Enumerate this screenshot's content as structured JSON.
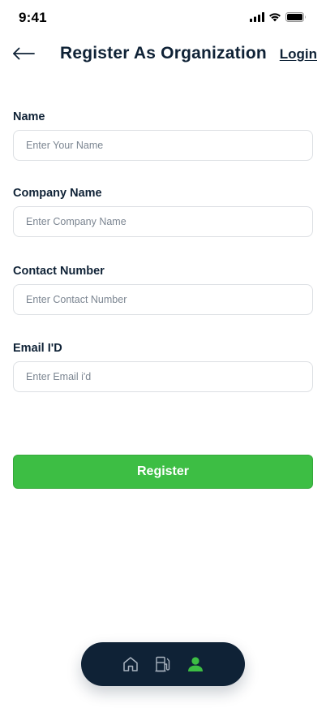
{
  "status_bar": {
    "time": "9:41",
    "icons": [
      "cellular-signal-icon",
      "wifi-icon",
      "battery-icon"
    ]
  },
  "header": {
    "back_icon": "arrow-left-icon",
    "title": "Register As Organization",
    "login_label": "Login"
  },
  "form": {
    "fields": [
      {
        "label": "Name",
        "placeholder": "Enter Your Name",
        "value": ""
      },
      {
        "label": "Company Name",
        "placeholder": "Enter Company Name",
        "value": ""
      },
      {
        "label": "Contact Number",
        "placeholder": "Enter Contact Number",
        "value": ""
      },
      {
        "label": "Email I'D",
        "placeholder": "Enter Email i'd",
        "value": ""
      }
    ],
    "submit_label": "Register"
  },
  "bottom_nav": {
    "items": [
      {
        "icon": "home-icon",
        "active": false
      },
      {
        "icon": "fuel-station-icon",
        "active": false
      },
      {
        "icon": "user-icon",
        "active": true
      }
    ]
  },
  "colors": {
    "primary_dark": "#0f2236",
    "accent_green": "#3dbe44",
    "input_border": "#dcdfe3",
    "placeholder": "#7b8591",
    "nav_inactive": "#a9b3bf"
  }
}
